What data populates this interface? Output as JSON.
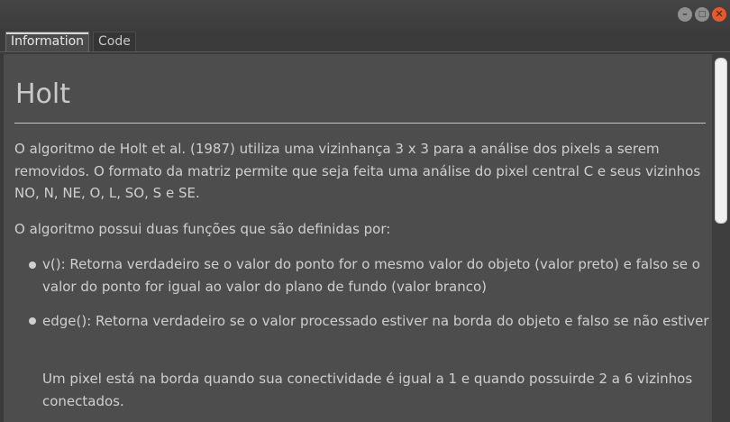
{
  "window": {
    "minimize_icon": "minimize-icon",
    "maximize_icon": "maximize-icon",
    "close_icon": "close-icon",
    "minimize_glyph": "–",
    "maximize_glyph": "□",
    "close_glyph": "✕"
  },
  "tabs": [
    {
      "label": "Information",
      "selected": true
    },
    {
      "label": "Code",
      "selected": false
    }
  ],
  "document": {
    "title": "Holt",
    "paragraph1": "O algoritmo de Holt et al. (1987) utiliza uma vizinhança 3 x 3 para a análise dos pixels a serem removidos. O formato da matriz permite que seja feita uma análise do pixel central C e seus vizinhos NO, N, NE, O, L, SO, S e SE.",
    "paragraph2": "O algoritmo possui duas funções que são definidas por:",
    "list": [
      "v(): Retorna verdadeiro se o valor do ponto for o mesmo valor do objeto (valor preto) e falso se o valor do ponto for igual ao valor do plano de fundo (valor branco)",
      "edge(): Retorna verdadeiro se o valor processado estiver na borda do objeto e falso se não estiver"
    ],
    "sub_paragraph": "Um pixel está na borda quando sua conectividade é igual a 1 e quando possuirde 2 a 6 vizinhos conectados."
  },
  "colors": {
    "close_button": "#e45a2c",
    "content_background": "#4d4d4d",
    "text": "#cfcfcf"
  }
}
